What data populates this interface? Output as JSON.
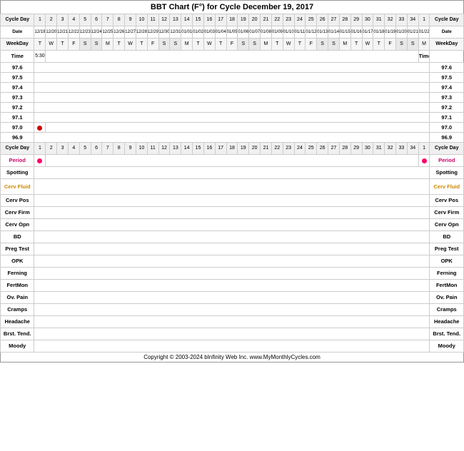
{
  "title": "BBT Chart (F°) for Cycle December 19, 2017",
  "footer": "Copyright © 2003-2024 bInfinity Web Inc.   www.MyMonthlyCycles.com",
  "cycleDays": [
    "1",
    "2",
    "3",
    "4",
    "5",
    "6",
    "7",
    "8",
    "9",
    "10",
    "11",
    "12",
    "13",
    "14",
    "15",
    "16",
    "17",
    "18",
    "19",
    "20",
    "21",
    "22",
    "23",
    "24",
    "25",
    "26",
    "27",
    "28",
    "29",
    "30",
    "31",
    "32",
    "33",
    "34",
    "1"
  ],
  "dates": [
    "12/19",
    "12/20",
    "12/21",
    "12/22",
    "12/23",
    "12/24",
    "12/25",
    "12/26",
    "12/27",
    "12/28",
    "12/29",
    "12/30",
    "12/31",
    "01/01",
    "01/02",
    "01/03",
    "01/04",
    "01/05",
    "01/06",
    "01/07",
    "01/08",
    "01/09",
    "01/10",
    "01/11",
    "01/12",
    "01/13",
    "01/14",
    "01/15",
    "01/16",
    "01/17",
    "01/18",
    "01/19",
    "01/20",
    "01/21",
    "01/22"
  ],
  "weekdays": [
    "T",
    "W",
    "T",
    "F",
    "S",
    "S",
    "M",
    "T",
    "W",
    "T",
    "F",
    "S",
    "S",
    "M",
    "T",
    "W",
    "T",
    "F",
    "S",
    "S",
    "M",
    "T",
    "W",
    "T",
    "F",
    "S",
    "S",
    "M",
    "T",
    "W",
    "T",
    "F",
    "S",
    "S",
    "M"
  ],
  "tempLabels": [
    "97.6",
    "97.5",
    "97.4",
    "97.3",
    "97.2",
    "97.1",
    "97.0",
    "96.9"
  ],
  "rows": {
    "time": "Time",
    "cycleDay": "Cycle Day",
    "date": "Date",
    "weekday": "WeekDay",
    "period": "Period",
    "spotting": "Spotting",
    "cervFluid": "Cerv Fluid",
    "cervPos": "Cerv Pos",
    "cervFirm": "Cerv Firm",
    "cervOpn": "Cerv Opn",
    "bd": "BD",
    "pregTest": "Preg Test",
    "opk": "OPK",
    "ferning": "Ferning",
    "fertMon": "FertMon",
    "ovPain": "Ov. Pain",
    "cramps": "Cramps",
    "headache": "Headache",
    "brstTend": "Brst. Tend.",
    "moody": "Moody"
  },
  "timeValue": "5:30",
  "periodDot1Col": 0,
  "periodDot2Col": 34,
  "tempDotCol": 1,
  "tempDotRow": 6
}
